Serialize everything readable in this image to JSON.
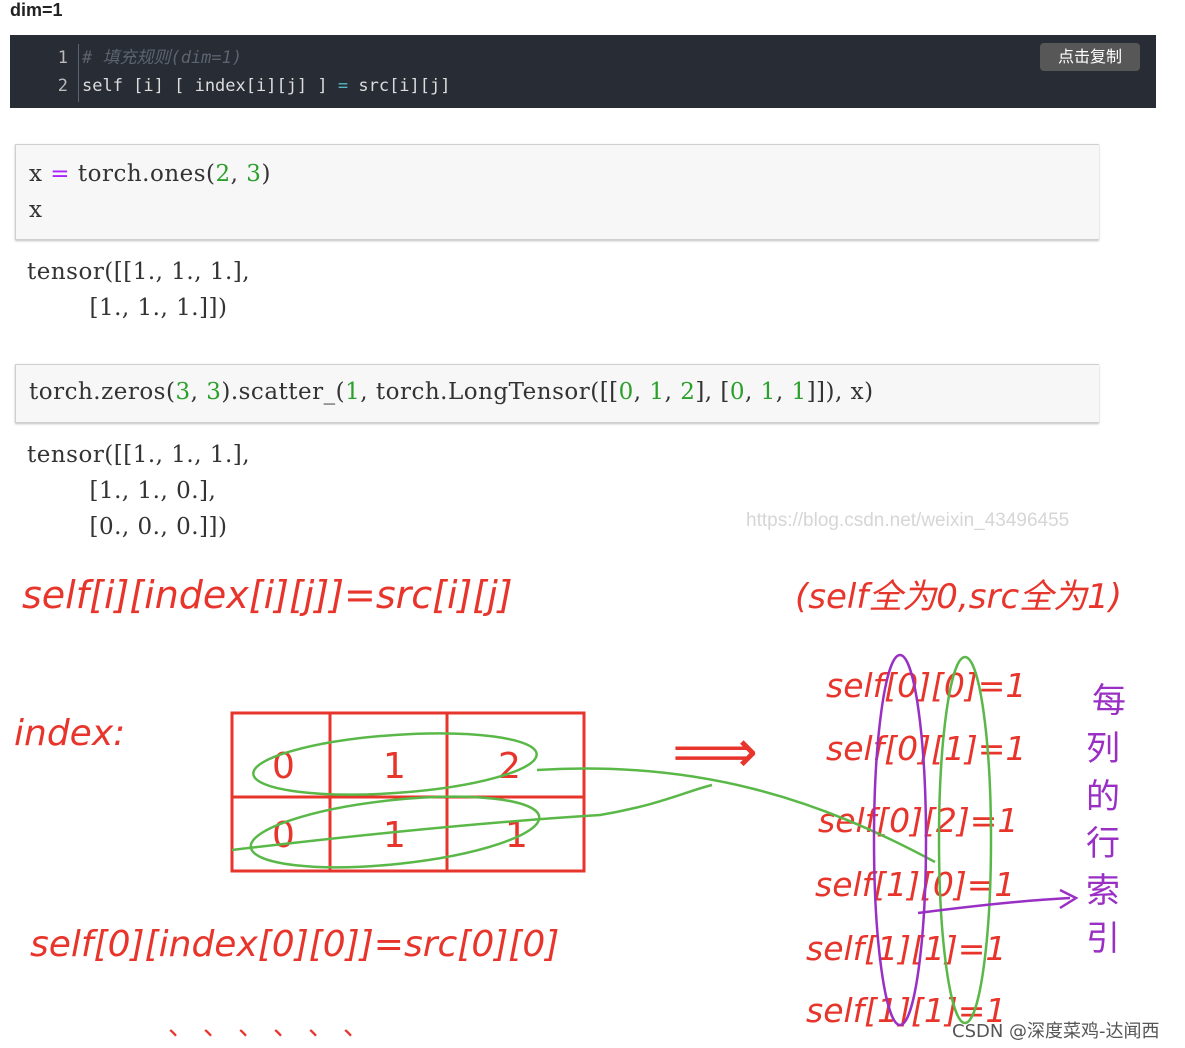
{
  "heading": "dim=1",
  "code_block": {
    "lines": [
      {
        "number": "1",
        "text": "# 填充规则(dim=1)"
      },
      {
        "number": "2",
        "text_a": "self [i] [ index[i][j] ] ",
        "text_eq": "=",
        "text_b": " src[i][j]"
      }
    ],
    "copy_button": "点击复制"
  },
  "cell1": {
    "line1": {
      "var": "x",
      "op": "=",
      "call": "torch.ones(",
      "a": "2",
      "comma": ", ",
      "b": "3",
      "close": ")"
    },
    "line2": "x"
  },
  "output1": {
    "lines": [
      "tensor([[1., 1., 1.],",
      "        [1., 1., 1.]])"
    ]
  },
  "cell2": {
    "p1": "torch.zeros(",
    "n1": "3",
    "p2": ", ",
    "n2": "3",
    "p3": ").scatter_(",
    "n3": "1",
    "p4": ", torch.LongTensor([[",
    "n4": "0",
    "p5": ", ",
    "n5": "1",
    "p6": ", ",
    "n6": "2",
    "p7": "], [",
    "n7": "0",
    "p8": ", ",
    "n8": "1",
    "p9": ", ",
    "n9": "1",
    "p10": "]]), x)"
  },
  "output2": {
    "lines": [
      "tensor([[1., 1., 1.],",
      "        [1., 1., 0.],",
      "        [0., 0., 0.]])"
    ]
  },
  "watermark": "https://blog.csdn.net/weixin_43496455",
  "handwriting": {
    "rule": "self[i][index[i][j]]=src[i][j]",
    "note": "(self全为0,src全为1)",
    "index_label": "index:",
    "index_table": [
      [
        "0",
        "1",
        "2"
      ],
      [
        "0",
        "1",
        "1"
      ]
    ],
    "arrow": "⟹",
    "results": [
      "self[0][0]=1",
      "self[0][1]=1",
      "self[0][2]=1",
      "self[1][0]=1",
      "self[1][1]=1",
      "self[1][1]=1"
    ],
    "example": "self[0][index[0][0]]=src[0][0]",
    "ellipsis": "、、、、、、",
    "side_note": [
      "每",
      "列",
      "的",
      "行",
      "索",
      "引"
    ]
  },
  "colors": {
    "hand_red": "#e8352c",
    "hand_green": "#5ab848",
    "hand_purple": "#9a2fc4"
  },
  "footer": "CSDN @深度菜鸡-达闻西"
}
